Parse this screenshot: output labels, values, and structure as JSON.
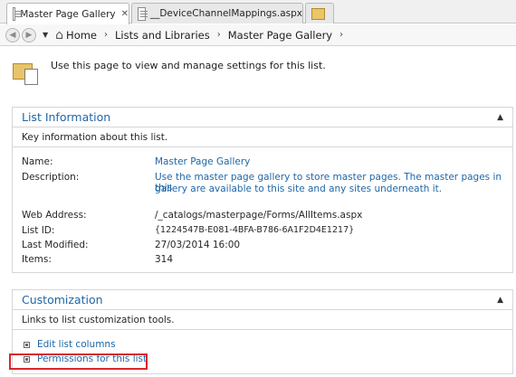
{
  "tabs": [
    {
      "label": "Master Page Gallery",
      "icon": "page-icon",
      "active": true
    },
    {
      "label": "__DeviceChannelMappings.aspx",
      "icon": "grid-page-icon",
      "active": false
    },
    {
      "label": "",
      "icon": "new-tab-icon",
      "active": false
    }
  ],
  "breadcrumb": {
    "items": [
      "Home",
      "Lists and Libraries",
      "Master Page Gallery"
    ],
    "separator": "›"
  },
  "intro": {
    "text": "Use this page to view and manage settings for this list."
  },
  "list_information": {
    "title": "List Information",
    "description": "Key information about this list.",
    "fields": {
      "name_label": "Name:",
      "name_value": "Master Page Gallery",
      "description_label": "Description:",
      "description_value_line1": "Use the master page gallery to store master pages. The master pages in this",
      "description_value_line2": "gallery are available to this site and any sites underneath it.",
      "web_address_label": "Web Address:",
      "web_address_value": "/_catalogs/masterpage/Forms/AllItems.aspx",
      "list_id_label": "List ID:",
      "list_id_value": "{1224547B-E081-4BFA-B786-6A1F2D4E1217}",
      "last_modified_label": "Last Modified:",
      "last_modified_value": "27/03/2014 16:00",
      "items_label": "Items:",
      "items_value": "314"
    }
  },
  "customization": {
    "title": "Customization",
    "description": "Links to list customization tools.",
    "links": [
      "Edit list columns",
      "Permissions for this list"
    ]
  },
  "colors": {
    "link": "#1f66a6",
    "highlight": "#d9262b"
  }
}
